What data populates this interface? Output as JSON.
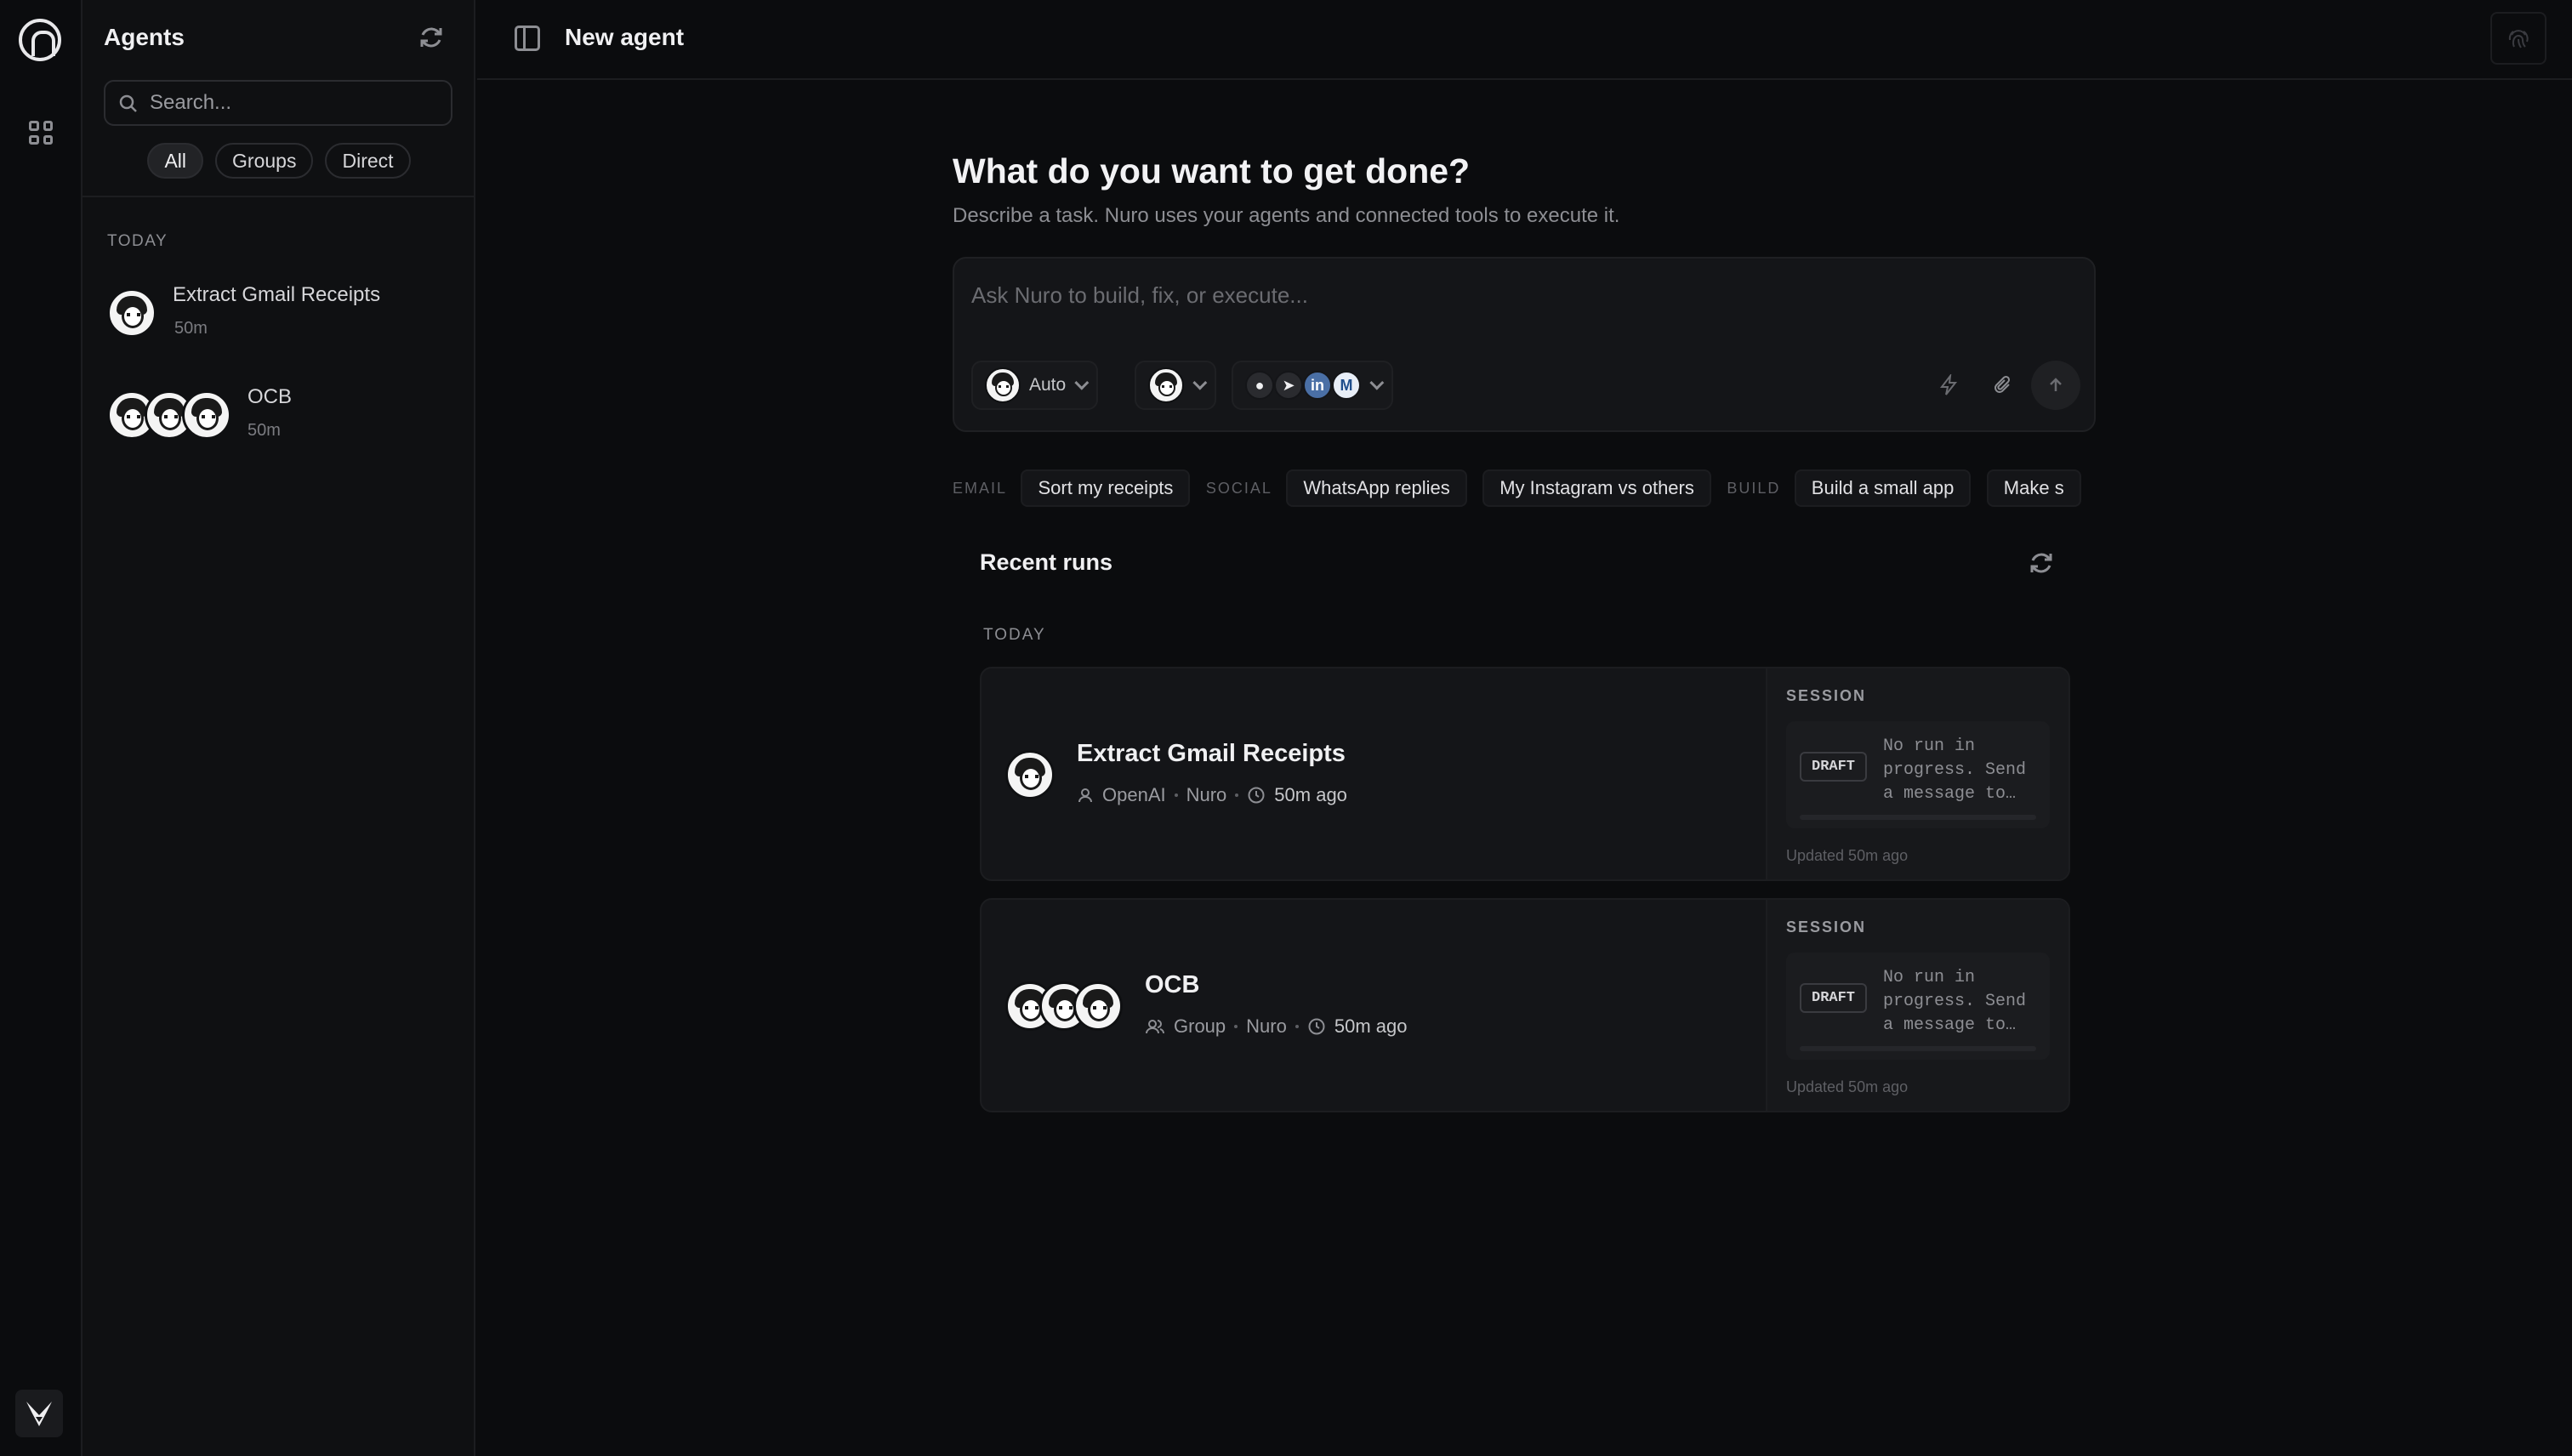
{
  "sidebar": {
    "title": "Agents",
    "search_placeholder": "Search...",
    "filters": [
      "All",
      "Groups",
      "Direct"
    ],
    "section": "TODAY",
    "items": [
      {
        "name": "Extract Gmail Receipts",
        "time": "50m"
      },
      {
        "name": "OCB",
        "time": "50m"
      }
    ]
  },
  "topbar": {
    "title": "New agent"
  },
  "hero": {
    "title": "What do you want to get done?",
    "subtitle": "Describe a task. Nuro uses your agents and connected tools to execute it.",
    "placeholder": "Ask Nuro to build, fix, or execute...",
    "model_label": "Auto"
  },
  "suggestions": {
    "email_label": "EMAIL",
    "email": [
      "Sort my receipts"
    ],
    "social_label": "SOCIAL",
    "social": [
      "WhatsApp replies",
      "My Instagram vs others"
    ],
    "build_label": "BUILD",
    "build": [
      "Build a small app",
      "Make s"
    ]
  },
  "runs": {
    "title": "Recent runs",
    "section": "TODAY",
    "cards": [
      {
        "title": "Extract Gmail Receipts",
        "owner": "OpenAI",
        "agent": "Nuro",
        "time": "50m ago",
        "session_label": "SESSION",
        "status": "DRAFT",
        "message": "No run in progress. Send a message to…",
        "updated": "Updated 50m ago"
      },
      {
        "title": "OCB",
        "owner": "Group",
        "agent": "Nuro",
        "time": "50m ago",
        "session_label": "SESSION",
        "status": "DRAFT",
        "message": "No run in progress. Send a message to…",
        "updated": "Updated 50m ago"
      }
    ]
  },
  "colors": {
    "background": "#0b0c0e",
    "panel": "#141518",
    "text": "#e8e8ea",
    "muted": "#8d8e93"
  }
}
